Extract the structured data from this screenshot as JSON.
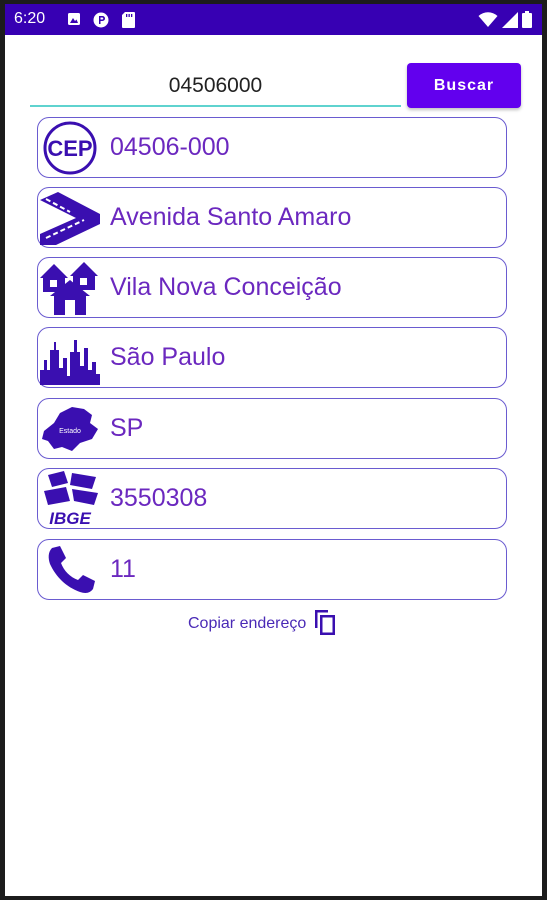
{
  "status_bar": {
    "time": "6:20",
    "left_icons": [
      "image-notification-icon",
      "circle-notification-icon",
      "sd-card-icon"
    ],
    "right_icons": [
      "wifi-icon",
      "signal-icon",
      "battery-icon"
    ],
    "color": "#3700b3"
  },
  "search": {
    "input_value": "04506000",
    "button_label": "Buscar"
  },
  "results": [
    {
      "icon": "cep-icon",
      "icon_text": "CEP",
      "value": "04506-000"
    },
    {
      "icon": "road-icon",
      "value": "Avenida Santo Amaro"
    },
    {
      "icon": "houses-icon",
      "value": "Vila Nova Conceição"
    },
    {
      "icon": "city-skyline-icon",
      "value": "São Paulo"
    },
    {
      "icon": "state-map-icon",
      "icon_text": "Estado",
      "value": "SP"
    },
    {
      "icon": "ibge-icon",
      "icon_text": "IBGE",
      "value": "3550308"
    },
    {
      "icon": "phone-icon",
      "value": "11"
    }
  ],
  "copy": {
    "label": "Copiar endereço",
    "icon": "copy-icon"
  },
  "colors": {
    "accent": "#6200ee",
    "text": "#6b28bf",
    "icon": "#3a0fb0",
    "underline": "#5fd3cf"
  }
}
